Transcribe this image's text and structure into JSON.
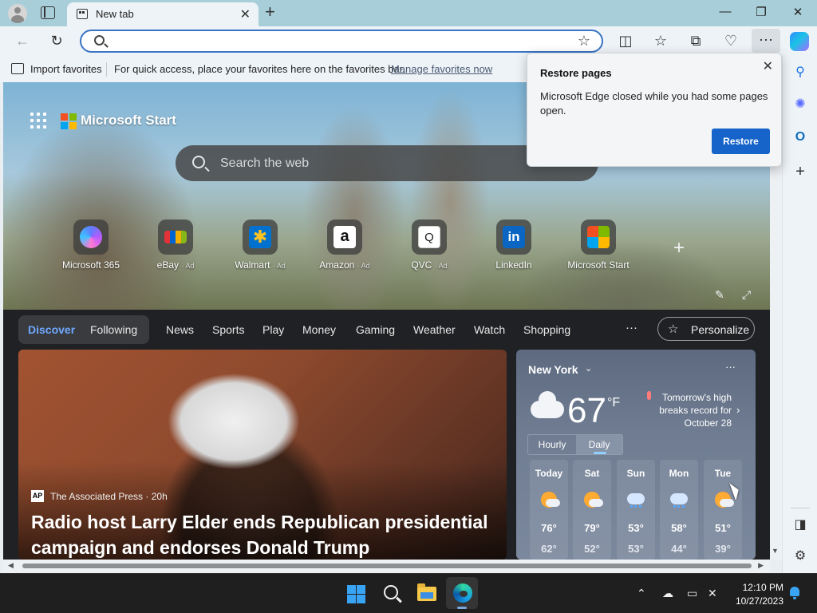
{
  "browser": {
    "tab": {
      "title": "New tab"
    },
    "window_controls": {
      "minimize": "—",
      "restore": "❐",
      "close": "✕"
    },
    "address_bar": {
      "value": "",
      "placeholder": ""
    },
    "favorites_bar": {
      "import_label": "Import favorites",
      "hint": "For quick access, place your favorites here on the favorites bar.",
      "manage_link": "Manage favorites now"
    },
    "more_button": "···"
  },
  "restore_flyout": {
    "title": "Restore pages",
    "message": "Microsoft Edge closed while you had some pages open.",
    "button": "Restore"
  },
  "start_page": {
    "brand": "Microsoft Start",
    "search_placeholder": "Search the web",
    "quick_links": [
      {
        "label": "Microsoft 365",
        "ad": "",
        "color": "#7b5cff"
      },
      {
        "label": "eBay",
        "ad": "· Ad",
        "color": "#e53238"
      },
      {
        "label": "Walmart",
        "ad": "· Ad",
        "color": "#0071ce"
      },
      {
        "label": "Amazon",
        "ad": "· Ad",
        "color": "#ffffff"
      },
      {
        "label": "QVC",
        "ad": "· Ad",
        "color": "#ffffff"
      },
      {
        "label": "LinkedIn",
        "ad": "",
        "color": "#0a66c2"
      },
      {
        "label": "Microsoft Start",
        "ad": "",
        "color": "#f25022"
      }
    ],
    "feed_nav": {
      "discover": "Discover",
      "following": "Following",
      "items": [
        "News",
        "Sports",
        "Play",
        "Money",
        "Gaming",
        "Weather",
        "Watch",
        "Shopping"
      ],
      "more": "···",
      "personalize": "Personalize"
    },
    "top_story": {
      "source_logo": "AP",
      "source": "The Associated Press · 20h",
      "headline": "Radio host Larry Elder ends Republican presidential campaign and endorses Donald Trump"
    },
    "weather": {
      "city": "New York",
      "temperature": "67",
      "unit": "°F",
      "alert": "Tomorrow's high breaks record for October 28",
      "tabs": {
        "hourly": "Hourly",
        "daily": "Daily"
      },
      "forecast": [
        {
          "day": "Today",
          "hi": "76°",
          "lo": "62°",
          "icon": "partly-sunny"
        },
        {
          "day": "Sat",
          "hi": "79°",
          "lo": "52°",
          "icon": "partly-sunny"
        },
        {
          "day": "Sun",
          "hi": "53°",
          "lo": "53°",
          "icon": "rain"
        },
        {
          "day": "Mon",
          "hi": "58°",
          "lo": "44°",
          "icon": "rain"
        },
        {
          "day": "Tue",
          "hi": "51°",
          "lo": "39°",
          "icon": "partly-sunny"
        }
      ]
    }
  },
  "taskbar": {
    "time": "12:10 PM",
    "date": "10/27/2023"
  }
}
